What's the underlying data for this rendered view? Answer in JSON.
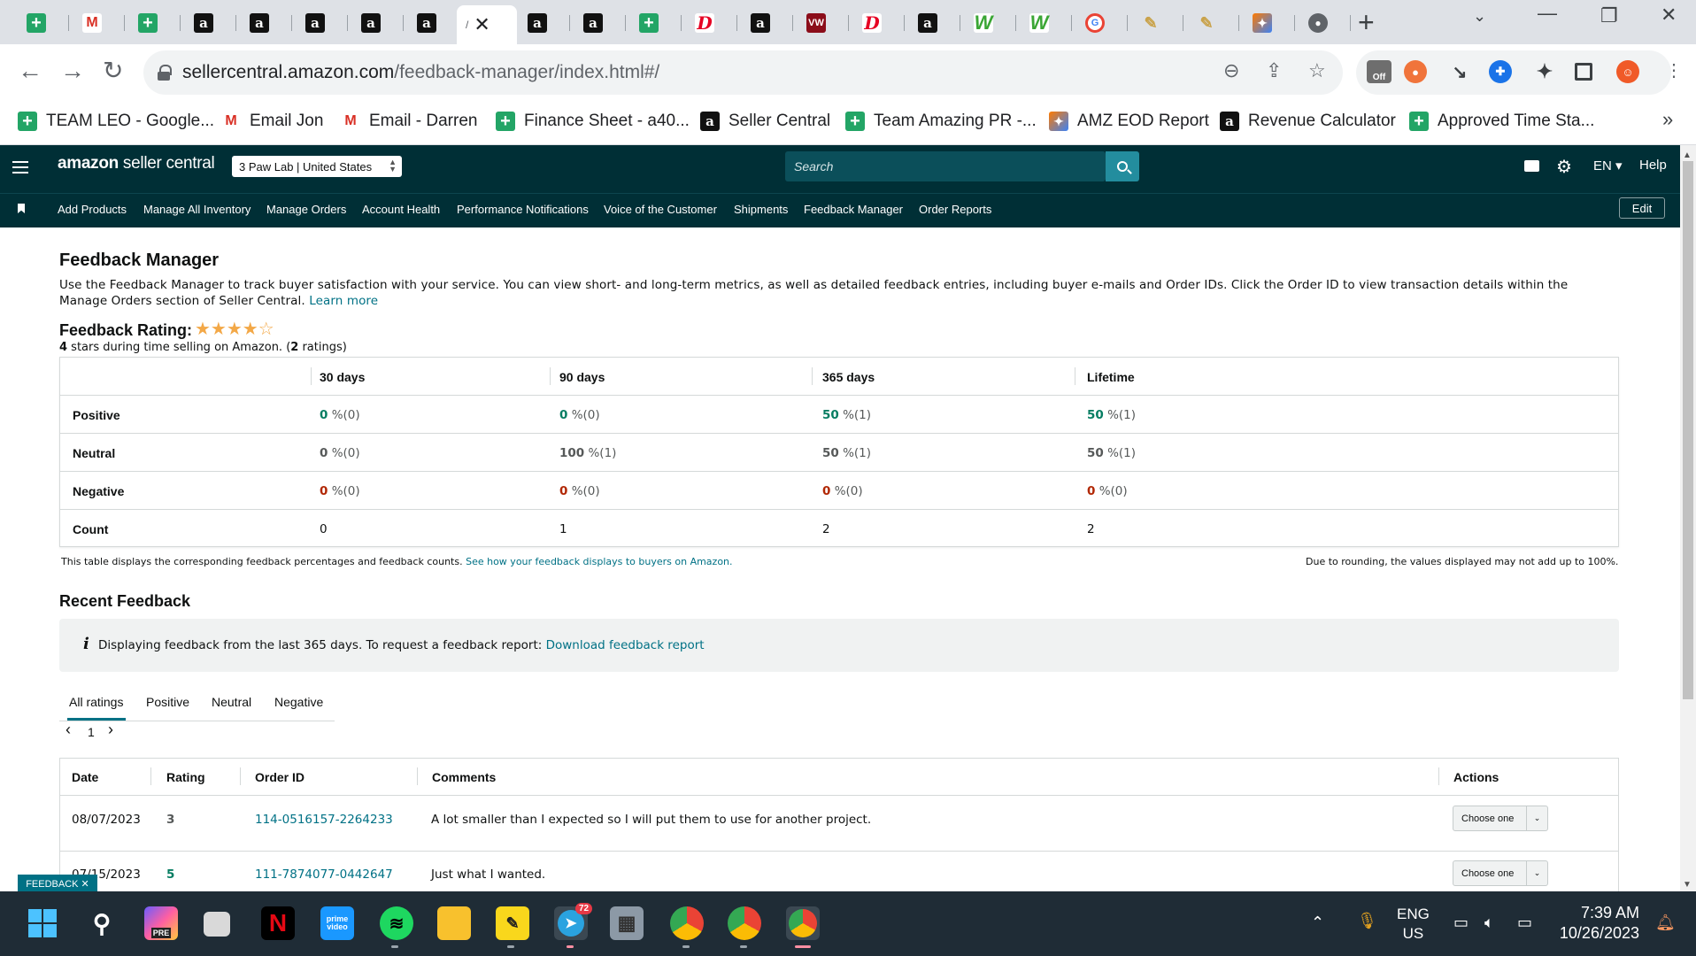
{
  "browser": {
    "active_tab_close": "✕",
    "new_tab": "+",
    "url_domain": "sellercentral.amazon.com",
    "url_path": "/feedback-manager/index.html#/",
    "tabs": [
      {
        "icon": "sheets-icon",
        "glyph": "+"
      },
      {
        "icon": "gmail-icon",
        "glyph": "M"
      },
      {
        "icon": "sheets-icon",
        "glyph": "+"
      },
      {
        "icon": "amazon-icon",
        "glyph": "a"
      },
      {
        "icon": "amazon-icon",
        "glyph": "a"
      },
      {
        "icon": "amazon-icon",
        "glyph": "a"
      },
      {
        "icon": "amazon-icon",
        "glyph": "a"
      },
      {
        "icon": "amazon-icon",
        "glyph": "a"
      },
      {
        "icon": "amazon-icon",
        "glyph": "a"
      },
      {
        "icon": "amazon-icon",
        "glyph": "a"
      },
      {
        "icon": "sheets-icon",
        "glyph": "+"
      },
      {
        "icon": "pinterest-icon",
        "glyph": "D"
      },
      {
        "icon": "amazon-icon",
        "glyph": "a"
      },
      {
        "icon": "vw-icon",
        "glyph": "VW"
      },
      {
        "icon": "pinterest-icon",
        "glyph": "D"
      },
      {
        "icon": "amazon-icon",
        "glyph": "a"
      },
      {
        "icon": "w-icon",
        "glyph": "W"
      },
      {
        "icon": "w-icon",
        "glyph": "W"
      },
      {
        "icon": "google-icon",
        "glyph": "G"
      },
      {
        "icon": "pen-icon",
        "glyph": "✎"
      },
      {
        "icon": "pen-icon",
        "glyph": "✎"
      },
      {
        "icon": "ai-icon",
        "glyph": "✦"
      },
      {
        "icon": "github-icon",
        "glyph": "●"
      }
    ],
    "bookmarks": [
      {
        "icon": "sheets-icon",
        "glyph": "+",
        "label": "TEAM LEO - Google..."
      },
      {
        "icon": "gmail-icon",
        "glyph": "M",
        "label": "Email Jon"
      },
      {
        "icon": "gmail-icon",
        "glyph": "M",
        "label": "Email - Darren"
      },
      {
        "icon": "sheets-icon",
        "glyph": "+",
        "label": "Finance Sheet - a40..."
      },
      {
        "icon": "amazon-icon",
        "glyph": "a",
        "label": "Seller Central"
      },
      {
        "icon": "sheets-icon",
        "glyph": "+",
        "label": "Team Amazing PR -..."
      },
      {
        "icon": "ai-icon",
        "glyph": "✦",
        "label": "AMZ EOD Report"
      },
      {
        "icon": "amazon-icon",
        "glyph": "a",
        "label": "Revenue Calculator"
      },
      {
        "icon": "sheets-icon",
        "glyph": "+",
        "label": "Approved Time Sta..."
      }
    ],
    "bookmarks_more": "»",
    "ext_off_badge": "Off"
  },
  "header": {
    "logo_amazon": "amazon",
    "logo_rest": " seller central",
    "account": "3 Paw Lab | United States",
    "search_placeholder": "Search",
    "lang": "EN ▾",
    "help": "Help",
    "nav": [
      "Add Products",
      "Manage All Inventory",
      "Manage Orders",
      "Account Health",
      "Performance Notifications",
      "Voice of the Customer",
      "Shipments",
      "Feedback Manager",
      "Order Reports"
    ],
    "edit": "Edit"
  },
  "page": {
    "title": "Feedback Manager",
    "intro": "Use the Feedback Manager to track buyer satisfaction with your service. You can view short- and long-term metrics, as well as detailed feedback entries, including buyer e-mails and Order IDs. Click the Order ID to view transaction details within the Manage Orders section of Seller Central.",
    "learn_more": "Learn more",
    "rating_label": "Feedback Rating:",
    "stars_filled": "★★★★",
    "stars_empty": "☆",
    "rating_value": 4,
    "rating_max": 5,
    "rating_sub_stars": "4",
    "rating_sub_mid": " stars during time selling on Amazon. (",
    "rating_sub_count": "2",
    "rating_sub_end": " ratings)"
  },
  "feedback_table": {
    "columns": [
      "30 days",
      "90 days",
      "365 days",
      "Lifetime"
    ],
    "rows": [
      {
        "label": "Positive",
        "cells": [
          {
            "v": "0",
            "p": " %(0)",
            "c": "green"
          },
          {
            "v": "0",
            "p": " %(0)",
            "c": "green"
          },
          {
            "v": "50",
            "p": " %(1)",
            "c": "green"
          },
          {
            "v": "50",
            "p": " %(1)",
            "c": "green"
          }
        ]
      },
      {
        "label": "Neutral",
        "cells": [
          {
            "v": "0",
            "p": " %(0)",
            "c": "gray"
          },
          {
            "v": "100",
            "p": " %(1)",
            "c": "gray"
          },
          {
            "v": "50",
            "p": " %(1)",
            "c": "gray"
          },
          {
            "v": "50",
            "p": " %(1)",
            "c": "gray"
          }
        ]
      },
      {
        "label": "Negative",
        "cells": [
          {
            "v": "0",
            "p": " %(0)",
            "c": "red"
          },
          {
            "v": "0",
            "p": " %(0)",
            "c": "red"
          },
          {
            "v": "0",
            "p": " %(0)",
            "c": "red"
          },
          {
            "v": "0",
            "p": " %(0)",
            "c": "red"
          }
        ]
      },
      {
        "label": "Count",
        "cells": [
          {
            "v": "0",
            "p": "",
            "c": "plain"
          },
          {
            "v": "1",
            "p": "",
            "c": "plain"
          },
          {
            "v": "2",
            "p": "",
            "c": "plain"
          },
          {
            "v": "2",
            "p": "",
            "c": "plain"
          }
        ]
      }
    ],
    "note_left": "This table displays the corresponding feedback percentages and feedback counts.",
    "note_link": "See how your feedback displays to buyers on Amazon.",
    "note_right": "Due to rounding, the values displayed may not add up to 100%."
  },
  "recent": {
    "title": "Recent Feedback",
    "info_icon": "i",
    "info_text": "Displaying feedback from the last 365 days. To request a feedback report:",
    "info_link": "Download feedback report",
    "tabs": [
      "All ratings",
      "Positive",
      "Neutral",
      "Negative"
    ],
    "pager_prev": "‹",
    "pager_page": "1",
    "pager_next": "›",
    "columns": [
      "Date",
      "Rating",
      "Order ID",
      "Comments",
      "Actions"
    ],
    "rows": [
      {
        "date": "08/07/2023",
        "rating": "3",
        "order": "114-0516157-2264233",
        "comment": "A lot smaller than I expected so I will put them to use for another project.",
        "action": "Choose one"
      },
      {
        "date": "07/15/2023",
        "rating": "5",
        "order": "111-7874077-0442647",
        "comment": "Just what I wanted.",
        "action": "Choose one"
      }
    ],
    "feedback_tag": "FEEDBACK ✕"
  },
  "taskbar": {
    "lang_top": "ENG",
    "lang_bottom": "US",
    "time": "7:39 AM",
    "date": "10/26/2023",
    "telegram_badge": "72",
    "copilot_badge": "PRE",
    "prime_label": "prime video"
  },
  "colors": {
    "header_bg": "#002f36",
    "link": "#007185",
    "positive": "#067d62",
    "negative": "#b12704",
    "star": "#f3a847"
  }
}
